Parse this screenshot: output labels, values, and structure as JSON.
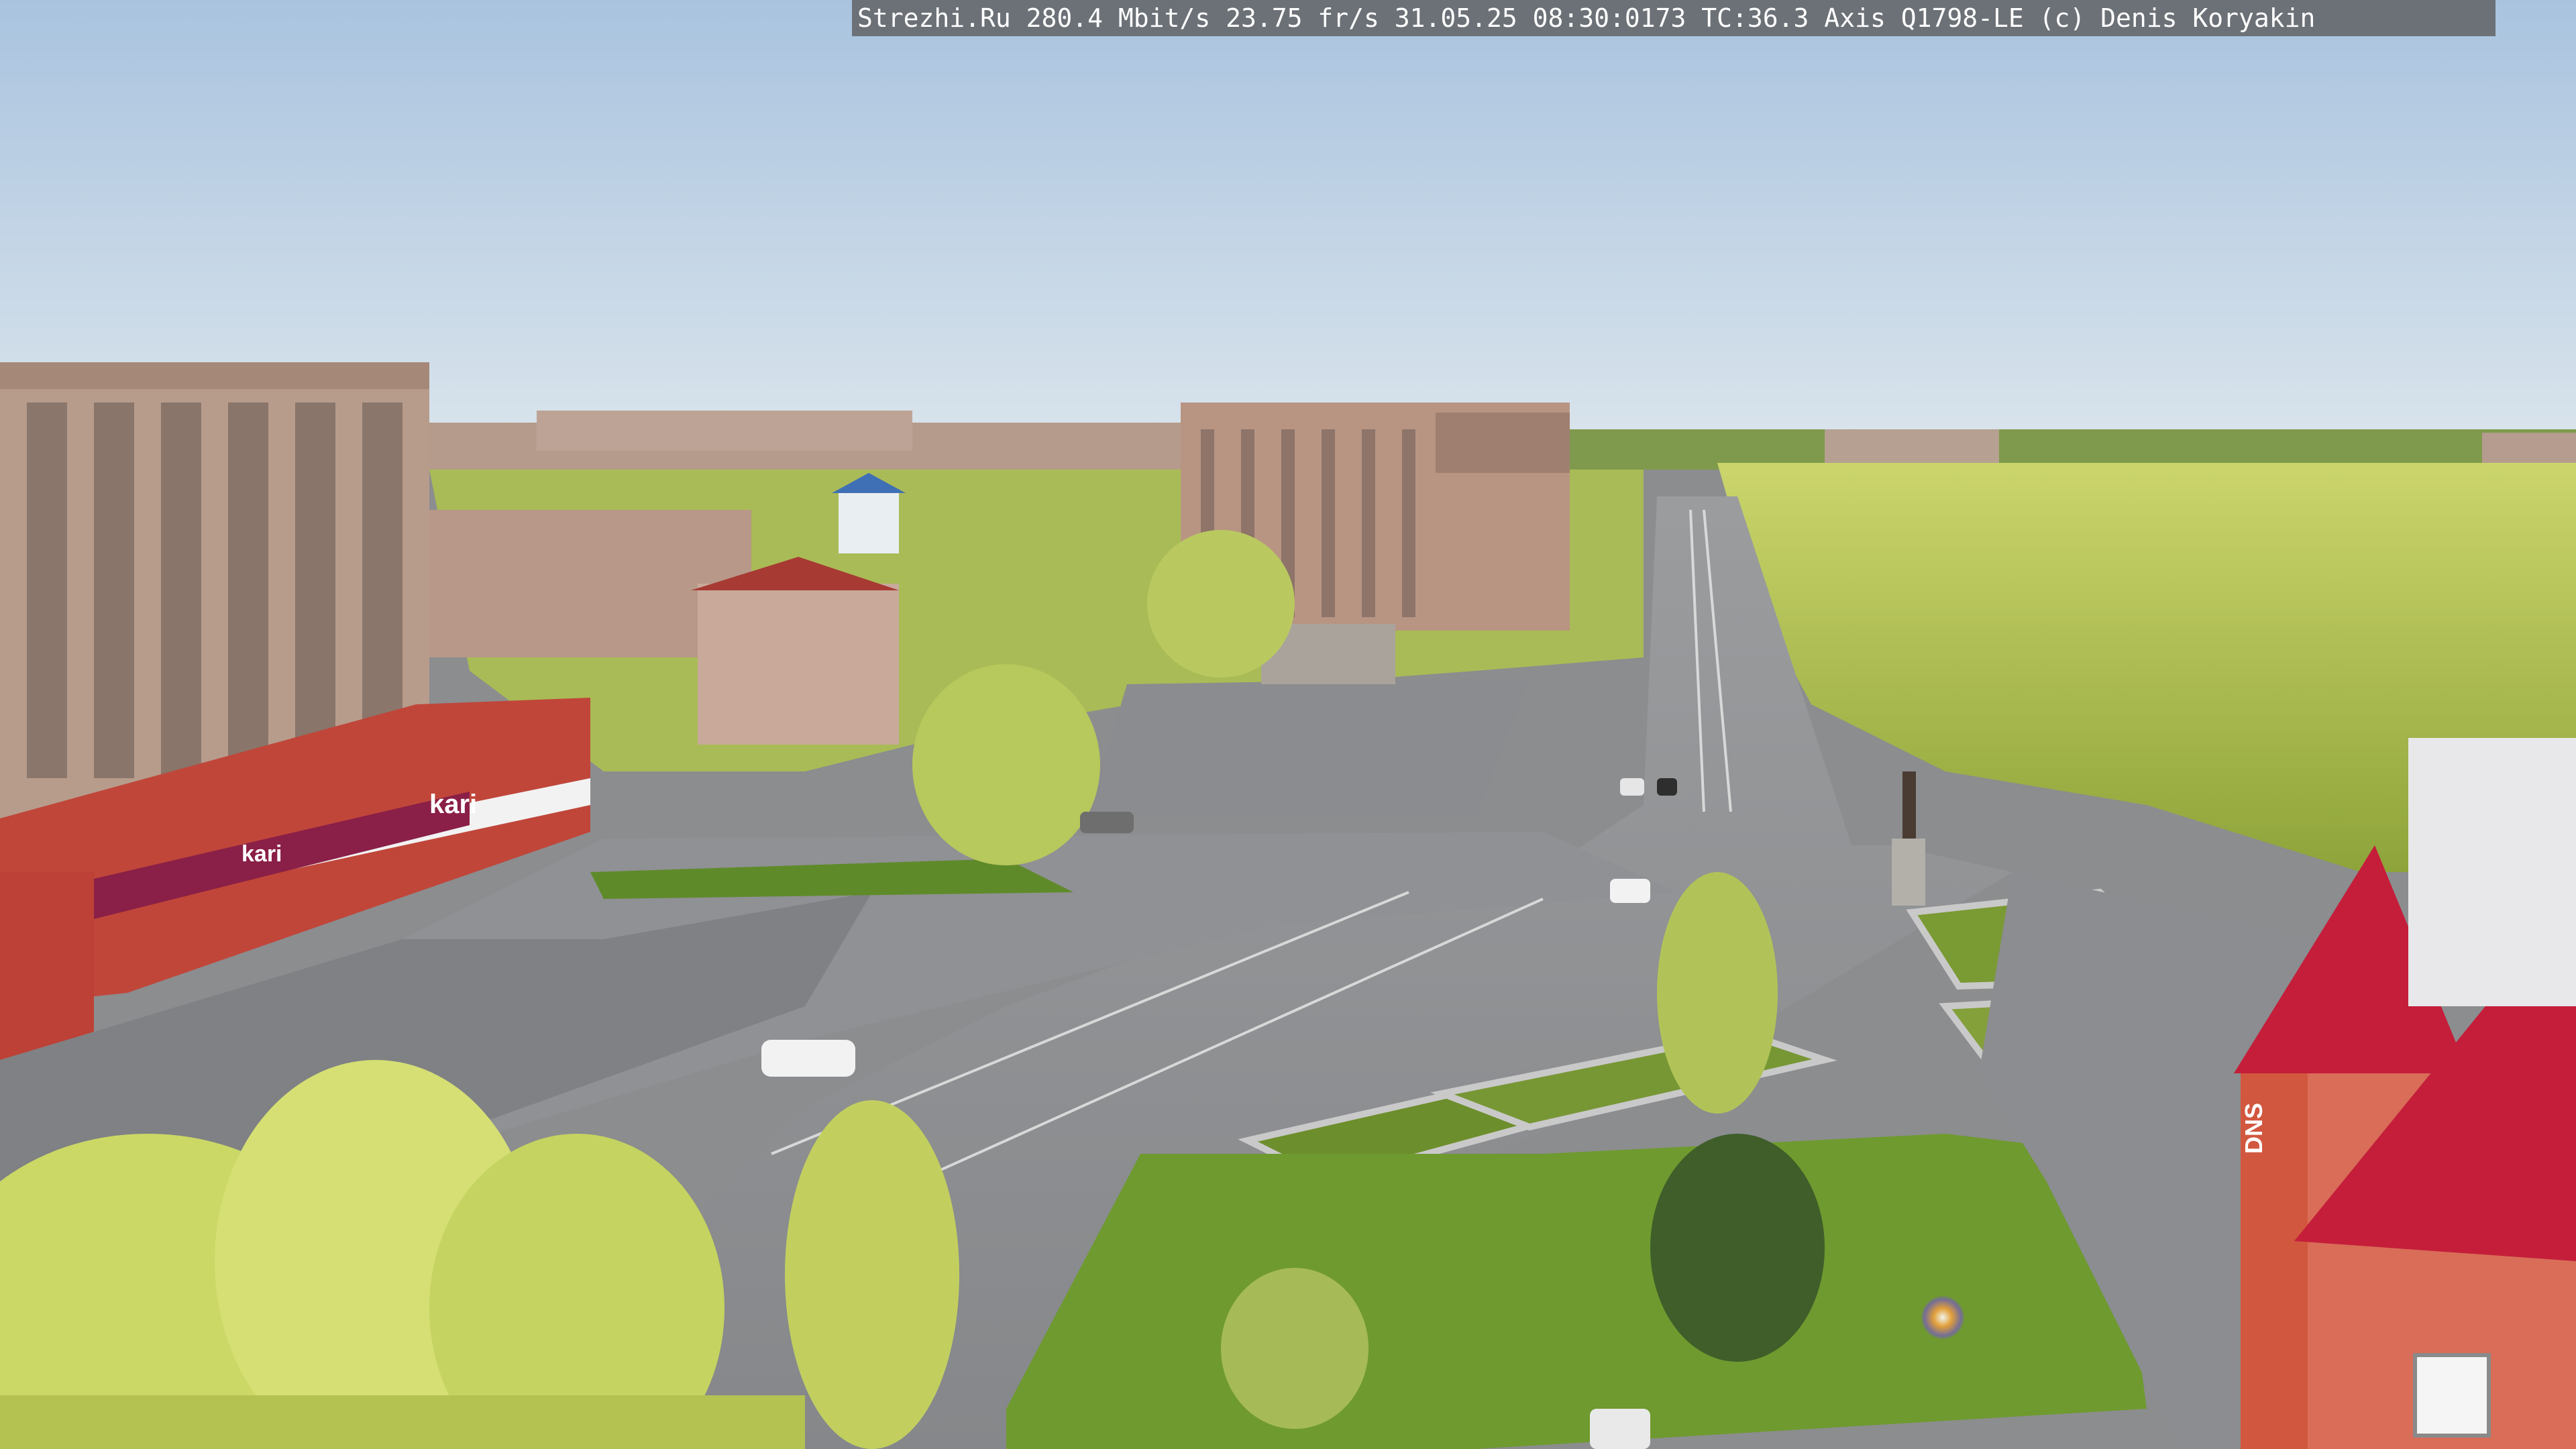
{
  "camera_overlay": {
    "text": "Strezhi.Ru 280.4 Mbit/s 23.75 fr/s 31.05.25 08:30:0173 TC:36.3  Axis Q1798-LE  (c) Denis Koryakin"
  },
  "storefront": {
    "brand_sign": "kari",
    "brand_sign_small": "kari",
    "right_building_sign": "DNS"
  },
  "colors": {
    "sky_top": "#a9c3df",
    "sky_bottom": "#d6e2ea",
    "asphalt": "#8e9093",
    "foliage": "#b8c95a",
    "store_facade": "#c0463a",
    "dns_facade": "#d2573f",
    "dns_roof": "#c41e3a"
  }
}
